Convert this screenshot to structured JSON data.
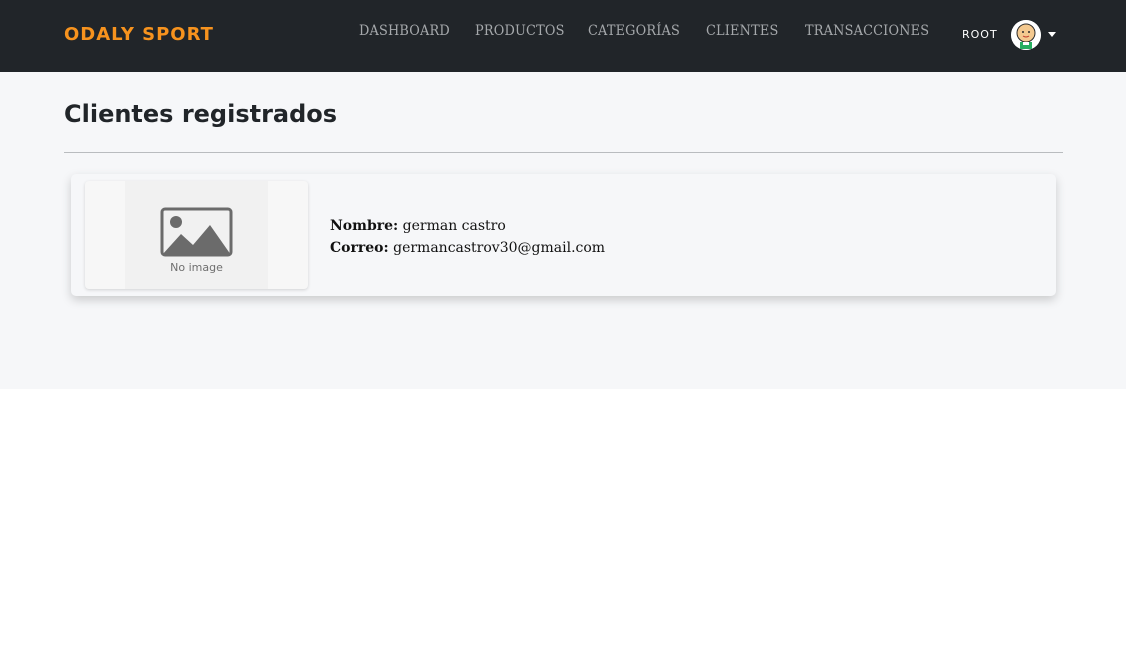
{
  "navbar": {
    "brand": "ODALY SPORT",
    "links": [
      {
        "label": "DASHBOARD"
      },
      {
        "label": "PRODUCTOS"
      },
      {
        "label": "CATEGORÍAS"
      },
      {
        "label": "CLIENTES"
      },
      {
        "label": "TRANSACCIONES"
      }
    ],
    "user": {
      "name": "ROOT",
      "avatar_icon": "user-avatar-icon",
      "caret_icon": "caret-down-icon"
    }
  },
  "page": {
    "title": "Clientes registrados"
  },
  "clients": [
    {
      "image_placeholder": "No image",
      "name_label": "Nombre:",
      "name": "german castro",
      "email_label": "Correo:",
      "email": "germancastrov30@gmail.com"
    }
  ],
  "colors": {
    "navbar_bg": "#212529",
    "brand": "#f7931e",
    "nav_link": "#a5a8ab",
    "page_bg": "#f6f7f9"
  }
}
